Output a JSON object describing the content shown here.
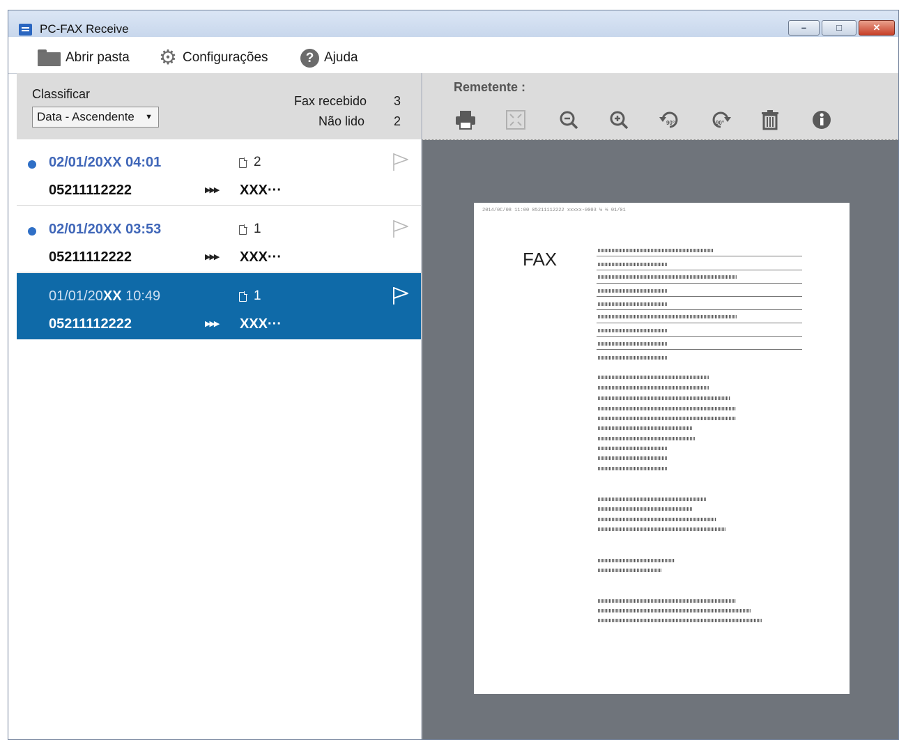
{
  "window": {
    "title": "PC-FAX Receive"
  },
  "toolbar": {
    "open_folder": "Abrir pasta",
    "settings": "Configurações",
    "help": "Ajuda"
  },
  "sort": {
    "label": "Classificar",
    "selected": "Data - Ascendente"
  },
  "stats": {
    "received_label": "Fax recebido",
    "received_count": "3",
    "unread_label": "Não lido",
    "unread_count": "2"
  },
  "faxes": [
    {
      "date": "02/01/20XX 04:01",
      "pages": "2",
      "number": "05211112222",
      "sender": "XXX···",
      "unread": true,
      "selected": false
    },
    {
      "date": "02/01/20XX 03:53",
      "pages": "1",
      "number": "05211112222",
      "sender": "XXX···",
      "unread": true,
      "selected": false
    },
    {
      "date_prefix": "01/01/20",
      "date_bold": "XX",
      "date_suffix": " 10:49",
      "pages": "1",
      "number": "05211112222",
      "sender": "XXX···",
      "unread": false,
      "selected": true
    }
  ],
  "preview": {
    "sender_label": "Remetente :",
    "sheet_title": "FAX",
    "sheet_header": "2014/0C/08  11:00   05211112222              xxxxx-0003                         ⅓ ⅔  01/01"
  },
  "colors": {
    "selected_row": "#0f6aa8",
    "unread_date": "#3f66b8",
    "unread_dot": "#2f6fc6",
    "preview_bg": "#6f747b"
  }
}
